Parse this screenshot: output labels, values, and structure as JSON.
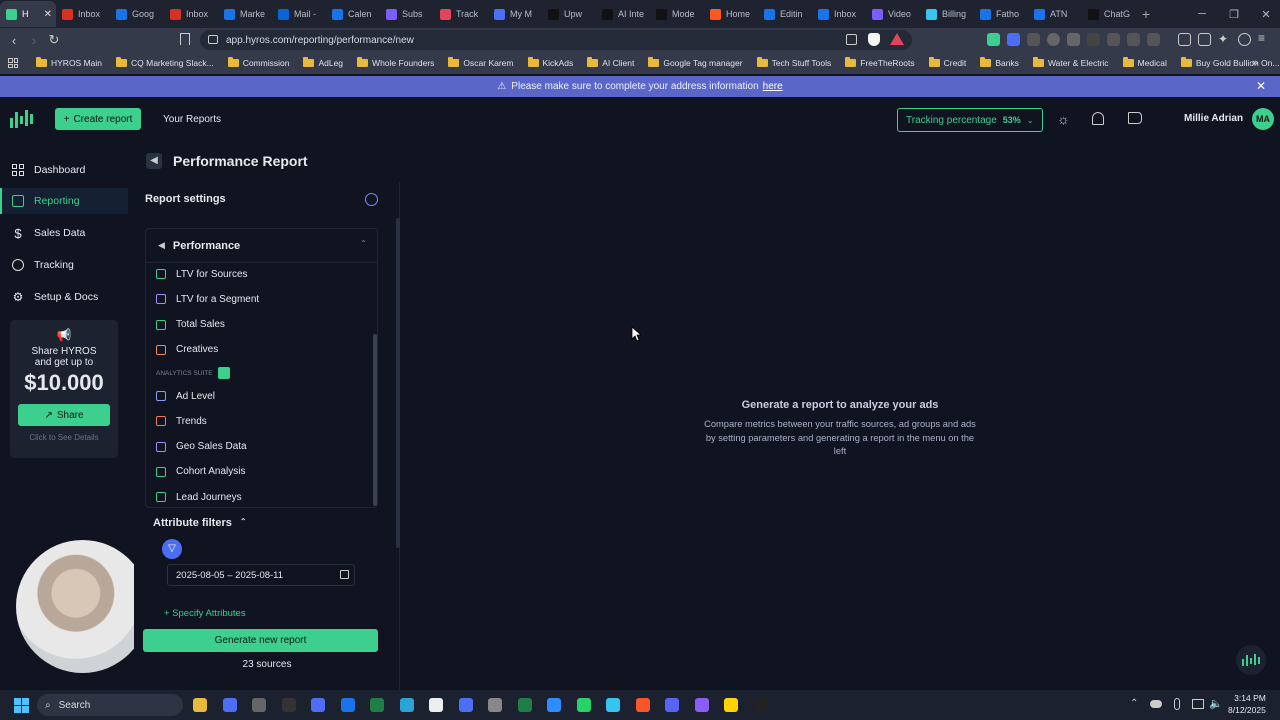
{
  "browser": {
    "tabs": [
      {
        "label": "H",
        "color": "#3ccf8e"
      },
      {
        "label": "Inbox",
        "color": "#d93025"
      },
      {
        "label": "Goog",
        "color": "#1a73e8"
      },
      {
        "label": "Inbox",
        "color": "#d93025"
      },
      {
        "label": "Marke",
        "color": "#1a73e8"
      },
      {
        "label": "Mail -",
        "color": "#0a64d6"
      },
      {
        "label": "Calen",
        "color": "#1a73e8"
      },
      {
        "label": "Subs",
        "color": "#7b5cff"
      },
      {
        "label": "Track",
        "color": "#e2445c"
      },
      {
        "label": "My M",
        "color": "#4c6ef5"
      },
      {
        "label": "Upw",
        "color": "#111"
      },
      {
        "label": "AI Inte",
        "color": "#111"
      },
      {
        "label": "Mode",
        "color": "#111"
      },
      {
        "label": "Home",
        "color": "#ff5722"
      },
      {
        "label": "Editin",
        "color": "#1a73e8"
      },
      {
        "label": "Inbox",
        "color": "#1a73e8"
      },
      {
        "label": "Video",
        "color": "#7b5cff"
      },
      {
        "label": "Billing",
        "color": "#36c5f0"
      },
      {
        "label": "Fatho",
        "color": "#1a73e8"
      },
      {
        "label": "ATN",
        "color": "#1a73e8"
      },
      {
        "label": "ChatG",
        "color": "#111"
      }
    ],
    "url": "app.hyros.com/reporting/performance/new",
    "bookmarks": [
      "HYROS Main",
      "CQ Marketing Slack...",
      "Commission",
      "AdLeg",
      "Whole Founders",
      "Oscar Karem",
      "KickAds",
      "AI Client",
      "Google Tag manager",
      "Tech Stuff Tools",
      "FreeTheRoots",
      "Credit",
      "Banks",
      "Water & Electric",
      "Medical",
      "Buy Gold Bullion On..."
    ]
  },
  "banner": {
    "text": "Please make sure to complete your address information",
    "link": "here"
  },
  "header": {
    "create_report": "Create report",
    "your_reports": "Your Reports",
    "tracking_label": "Tracking percentage",
    "tracking_value": "53%",
    "user_name": "Millie Adrian",
    "user_initials": "MA"
  },
  "sidebar": {
    "items": [
      {
        "label": "Dashboard",
        "icon": "grid-icon"
      },
      {
        "label": "Reporting",
        "icon": "bar-chart-icon"
      },
      {
        "label": "Sales Data",
        "icon": "dollar-icon"
      },
      {
        "label": "Tracking",
        "icon": "target-icon"
      },
      {
        "label": "Setup & Docs",
        "icon": "settings-icon"
      }
    ],
    "share": {
      "line1": "Share HYROS",
      "line2": "and get up to",
      "amount": "$10.000",
      "button": "Share",
      "details": "Click to See Details"
    }
  },
  "page": {
    "title": "Performance Report"
  },
  "report_settings": {
    "title": "Report settings",
    "group": "Performance",
    "items": [
      {
        "label": "LTV for Sources",
        "color": "#3ccf8e"
      },
      {
        "label": "LTV for a Segment",
        "color": "#a78bfa"
      },
      {
        "label": "Total Sales",
        "color": "#3ccf8e"
      },
      {
        "label": "Creatives",
        "color": "#f08b5a"
      }
    ],
    "suite_label": "ANALYTICS SUITE",
    "suite_items": [
      {
        "label": "Ad Level",
        "color": "#8b9cf5"
      },
      {
        "label": "Trends",
        "color": "#f07a5a"
      },
      {
        "label": "Geo Sales Data",
        "color": "#a78bfa"
      },
      {
        "label": "Cohort Analysis",
        "color": "#3ccf8e"
      },
      {
        "label": "Lead Journeys",
        "color": "#3ccf8e"
      }
    ],
    "attribute_filters": "Attribute filters",
    "date_range": "2025-08-05 – 2025-08-11",
    "specify": "+ Specify Attributes",
    "generate": "Generate new report",
    "sources": "23 sources"
  },
  "empty_state": {
    "title": "Generate a report to analyze your ads",
    "body": "Compare metrics between your traffic sources, ad groups and ads by setting parameters and generating a report in the menu on the left"
  },
  "taskbar": {
    "search": "Search",
    "time": "3:14 PM",
    "date": "8/12/2025"
  }
}
